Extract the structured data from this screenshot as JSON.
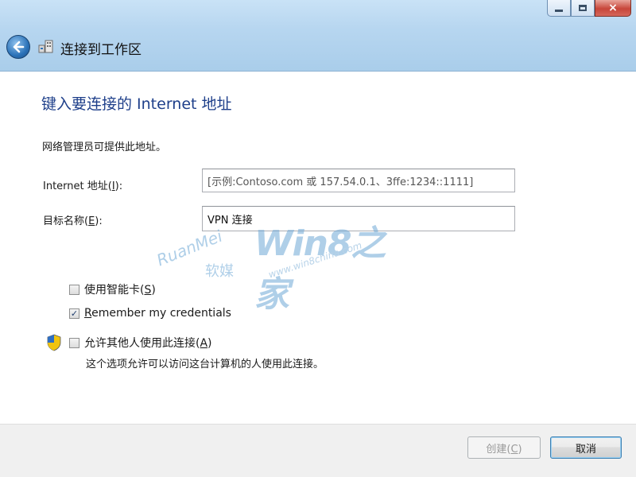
{
  "window": {
    "title": "连接到工作区",
    "controls": {
      "minimize": "minimize-icon",
      "maximize": "maximize-icon",
      "close": "×"
    }
  },
  "heading": "键入要连接的 Internet 地址",
  "intro": "网络管理员可提供此地址。",
  "fields": {
    "internet_address": {
      "label_prefix": "Internet 地址(",
      "label_key": "I",
      "label_suffix": "):",
      "placeholder": "[示例:Contoso.com 或 157.54.0.1、3ffe:1234::1111]",
      "value": ""
    },
    "destination_name": {
      "label_prefix": "目标名称(",
      "label_key": "E",
      "label_suffix": "):",
      "value": "VPN 连接"
    }
  },
  "options": {
    "smart_card": {
      "prefix": "使用智能卡(",
      "key": "S",
      "suffix": ")",
      "checked": false
    },
    "remember": {
      "key": "R",
      "text": "emember my credentials",
      "checked": true,
      "mark": "✓"
    },
    "allow_others": {
      "prefix": "允许其他人使用此连接(",
      "key": "A",
      "suffix": ")",
      "checked": false,
      "note": "这个选项允许可以访问这台计算机的人使用此连接。"
    }
  },
  "watermark": {
    "main": "Win8之家",
    "sub": "www.win8china.com",
    "left": "RuanMei",
    "left_cn": "软媒"
  },
  "buttons": {
    "create": {
      "prefix": "创建(",
      "key": "C",
      "suffix": ")",
      "enabled": false
    },
    "cancel": {
      "label": "取消"
    }
  },
  "colors": {
    "heading": "#1e3f8a",
    "titlebar": "#b7d6f0",
    "accent": "#2b72b8"
  }
}
